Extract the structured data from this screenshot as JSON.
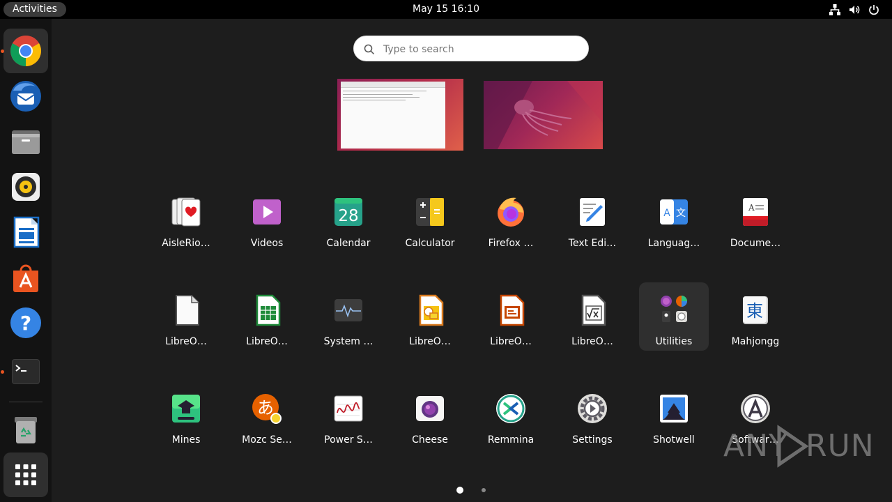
{
  "topbar": {
    "activities": "Activities",
    "clock": "May 15  16:10",
    "tray": [
      "network-icon",
      "volume-icon",
      "power-icon"
    ]
  },
  "dock": {
    "items": [
      {
        "name": "Google Chrome",
        "icon": "chrome-icon",
        "active": true,
        "running": true
      },
      {
        "name": "Thunderbird Mail",
        "icon": "thunderbird-icon",
        "running": false
      },
      {
        "name": "Files",
        "icon": "files-icon",
        "running": false
      },
      {
        "name": "Rhythmbox",
        "icon": "rhythmbox-icon",
        "running": false
      },
      {
        "name": "LibreOffice Writer",
        "icon": "writer-icon",
        "running": false
      },
      {
        "name": "Ubuntu Software",
        "icon": "software-icon",
        "running": false
      },
      {
        "name": "Help",
        "icon": "help-icon",
        "running": false
      },
      {
        "name": "Terminal",
        "icon": "terminal-icon",
        "running": true
      },
      {
        "name": "Trash",
        "icon": "trash-icon",
        "running": false
      },
      {
        "name": "Show Applications",
        "icon": "app-grid-icon",
        "running": false
      }
    ]
  },
  "search": {
    "placeholder": "Type to search"
  },
  "apps": {
    "row1": [
      "AisleRio…",
      "Videos",
      "Calendar",
      "Calculator",
      "Firefox …",
      "Text Edi…",
      "Languag…",
      "Docume…"
    ],
    "row2": [
      "LibreO…",
      "LibreO…",
      "System …",
      "LibreO…",
      "LibreO…",
      "LibreO…",
      "Utilities",
      "Mahjongg"
    ],
    "row3": [
      "Mines",
      "Mozc Se…",
      "Power S…",
      "Cheese",
      "Remmina",
      "Settings",
      "Shotwell",
      "Softwar…"
    ]
  },
  "calendar_day": "28",
  "mahjongg_glyph": "東",
  "mozc_glyph": "あ",
  "pages": {
    "count": 2,
    "current": 1
  },
  "watermark": "ANY RUN",
  "colors": {
    "accent": "#e95420",
    "panel": "#000000",
    "dock": "#131313",
    "background": "#1d1d1d"
  }
}
